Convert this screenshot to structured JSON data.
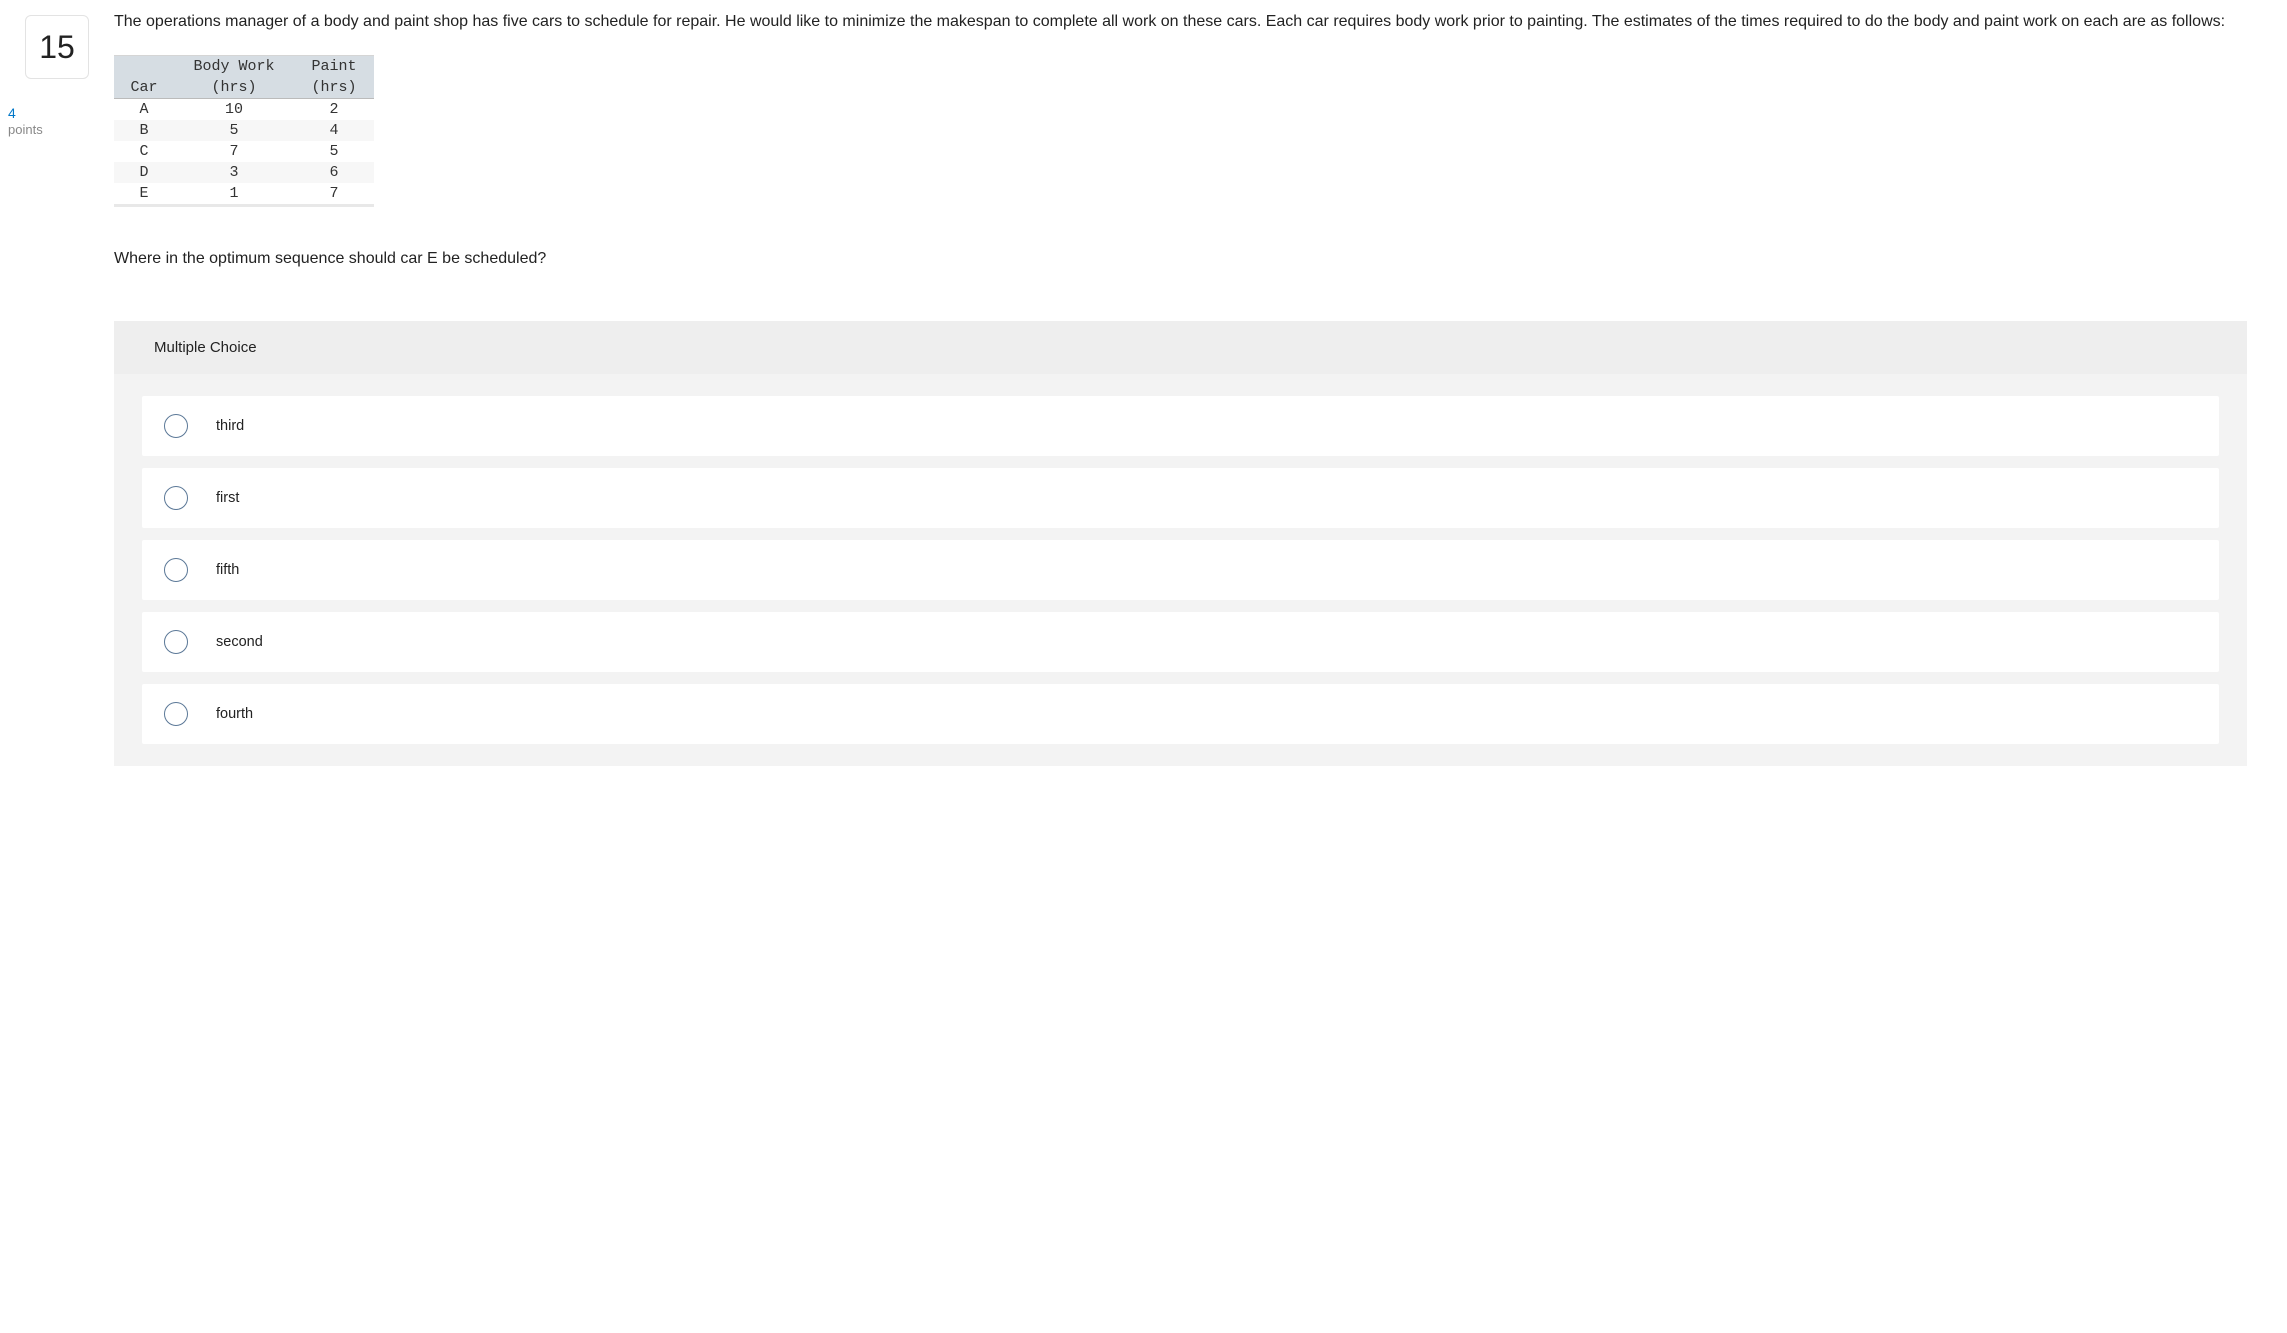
{
  "question": {
    "number": "15",
    "points_value": "4",
    "points_label": "points",
    "intro_text": "The operations manager of a body and paint shop has five cars to schedule for repair. He would like to minimize the makespan to complete all work on these cars. Each car requires body work prior to painting. The estimates of the times required to do the body and paint work on each are as follows:",
    "followup_text": "Where in the optimum sequence should car E be scheduled?"
  },
  "table": {
    "headers": {
      "car": "Car",
      "body_top": "Body Work",
      "body_bot": "(hrs)",
      "paint_top": "Paint",
      "paint_bot": "(hrs)"
    },
    "rows": [
      {
        "car": "A",
        "body": "10",
        "paint": "2"
      },
      {
        "car": "B",
        "body": "5",
        "paint": "4"
      },
      {
        "car": "C",
        "body": "7",
        "paint": "5"
      },
      {
        "car": "D",
        "body": "3",
        "paint": "6"
      },
      {
        "car": "E",
        "body": "1",
        "paint": "7"
      }
    ]
  },
  "mc": {
    "title": "Multiple Choice",
    "options": [
      {
        "label": "third"
      },
      {
        "label": "first"
      },
      {
        "label": "fifth"
      },
      {
        "label": "second"
      },
      {
        "label": "fourth"
      }
    ]
  }
}
